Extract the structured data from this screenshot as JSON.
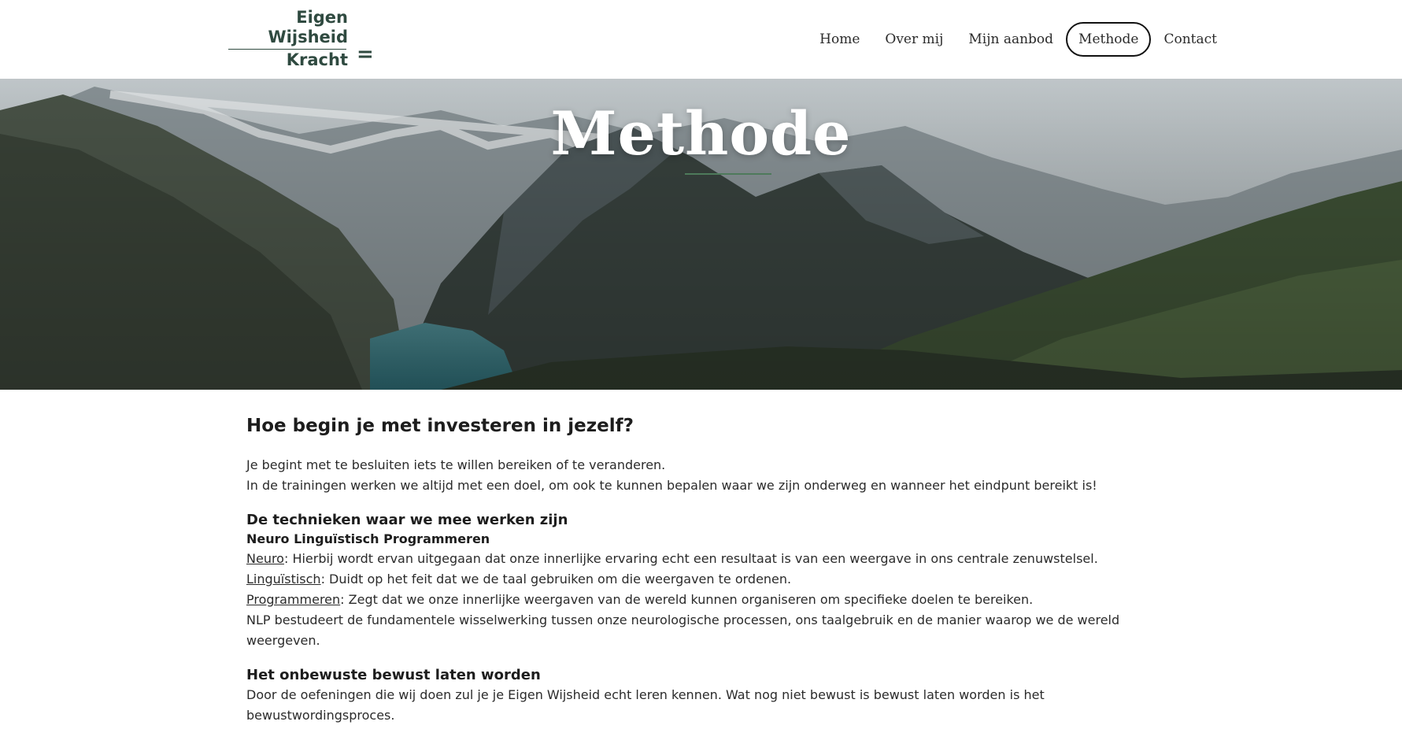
{
  "brand": {
    "logo_line1": "Eigen",
    "logo_line2": "Wijsheid",
    "logo_line3": "Kracht",
    "logo_mark": "=",
    "color": "#2f4a40"
  },
  "nav": {
    "items": [
      {
        "label": "Home"
      },
      {
        "label": "Over mij"
      },
      {
        "label": "Mijn aanbod"
      },
      {
        "label": "Methode",
        "active": true
      },
      {
        "label": "Contact"
      }
    ]
  },
  "hero": {
    "title": "Methode",
    "image": "mountain-valley-lake"
  },
  "content": {
    "heading": "Hoe begin je met investeren in jezelf?",
    "intro_line1": "Je begint met te besluiten iets te willen bereiken of te veranderen.",
    "intro_line2": "In de trainingen werken we altijd met een doel, om ook te kunnen bepalen waar we zijn onderweg en wanneer het eindpunt bereikt is!",
    "techniques_heading": "De technieken waar we mee werken zijn",
    "nlp_title": "Neuro  Linguïstisch Programmeren",
    "neuro_term": "Neuro",
    "neuro_text": ": Hierbij wordt ervan uitgegaan dat onze innerlijke ervaring echt een resultaat is van een weergave in ons centrale zenuwstelsel.",
    "ling_term": "Linguïstisch",
    "ling_text": ":  Duidt op het feit dat we de taal gebruiken om die weergaven te ordenen.",
    "prog_term": "Programmeren",
    "prog_text": ": Zegt  dat we onze innerlijke weergaven van de wereld kunnen organiseren om specifieke doelen te bereiken.",
    "nlp_summary": "NLP bestudeert de fundamentele wisselwerking tussen onze neurologische processen, ons taalgebruik en de manier waarop we de wereld weergeven.",
    "unconscious_heading": "Het onbewuste bewust laten worden",
    "unconscious_text": "Door de oefeningen die wij doen zul je je Eigen Wijsheid echt leren kennen. Wat nog niet bewust is bewust laten worden is het bewustwordingsproces."
  }
}
